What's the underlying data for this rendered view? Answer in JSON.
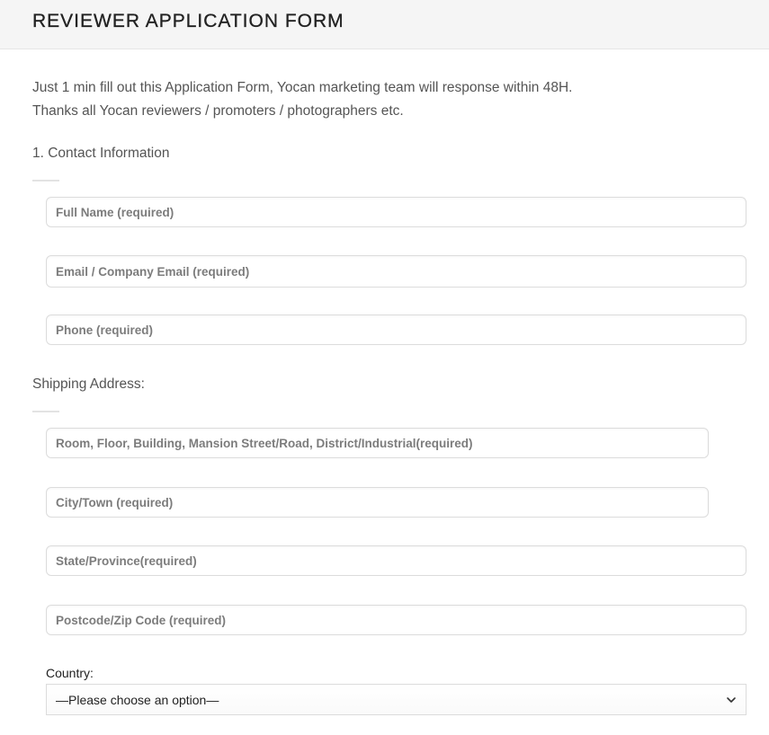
{
  "header": {
    "title": "REVIEWER APPLICATION FORM"
  },
  "intro": {
    "line1": "Just 1 min fill out this Application Form, Yocan marketing team will response within 48H.",
    "line2": "Thanks all Yocan reviewers / promoters / photographers etc."
  },
  "contact": {
    "title": "1. Contact Information",
    "full_name_placeholder": "Full Name (required)",
    "email_placeholder": "Email / Company Email (required)",
    "phone_placeholder": "Phone (required)"
  },
  "shipping": {
    "title": "Shipping Address:",
    "address_placeholder": "Room, Floor, Building, Mansion Street/Road, District/Industrial(required)",
    "city_placeholder": "City/Town (required)",
    "state_placeholder": "State/Province(required)",
    "postcode_placeholder": "Postcode/Zip Code (required)"
  },
  "country": {
    "label": "Country:",
    "selected": "—Please choose an option—",
    "icon": "chevron-down-icon"
  }
}
